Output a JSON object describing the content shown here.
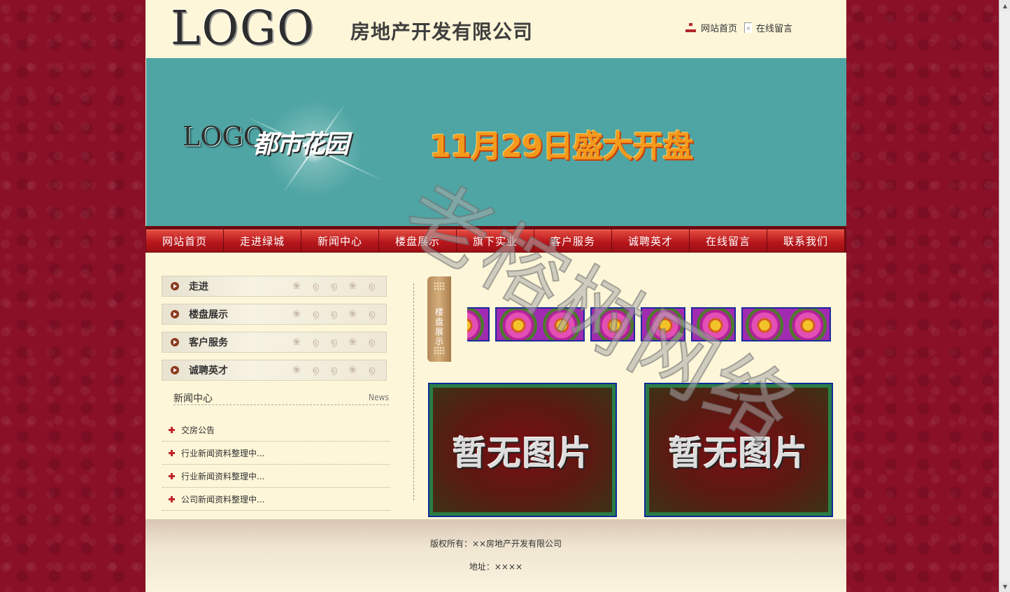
{
  "header": {
    "logo": "LOGO",
    "company": "房地产开发有限公司",
    "links": [
      "网站首页",
      "在线留言"
    ]
  },
  "banner": {
    "logo": "LOGO",
    "brand": "都市花园",
    "headline": "11月29日盛大开盘"
  },
  "nav": [
    "网站首页",
    "走进绿城",
    "新闻中心",
    "楼盘展示",
    "旗下实业",
    "客户服务",
    "诚聘英才",
    "在线留言",
    "联系我们"
  ],
  "sidebar": {
    "buttons": [
      "走进",
      "楼盘展示",
      "客户服务",
      "诚聘英才"
    ],
    "news_title": "新闻中心",
    "news_title_en": "News",
    "news": [
      "交房公告",
      "行业新闻资料整理中...",
      "行业新闻资料整理中...",
      "公司新闻资料整理中..."
    ]
  },
  "showcase": {
    "tab_label": "楼盘展示",
    "no_image": "暂无图片"
  },
  "footer": {
    "copyright": "版权所有：××房地产开发有限公司",
    "address": "地址：××××"
  },
  "watermark": "老榕树网络"
}
